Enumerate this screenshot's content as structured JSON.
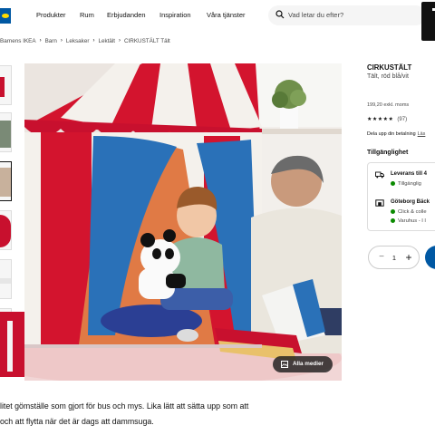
{
  "header": {
    "nav": [
      "Produkter",
      "Rum",
      "Erbjudanden",
      "Inspiration",
      "Våra tjänster"
    ],
    "search_placeholder": "Vad letar du efter?"
  },
  "breadcrumb": [
    "Barnens IKEA",
    "Barn",
    "Leksaker",
    "Lektält",
    "CIRKUSTÄLT Tält"
  ],
  "gallery": {
    "media_button": "Alla medier"
  },
  "product": {
    "name": "CIRKUSTÄLT",
    "subtitle": "Tält, röd blå/vit",
    "price": "199,20 exkl. moms",
    "rating_stars": "★★★★★",
    "rating_count": "(97)",
    "split_text": "Dela upp din betalning",
    "split_link": "Läs",
    "availability_title": "Tillgänglighet",
    "delivery": {
      "title": "Leverans till 4",
      "status": "Tillgänglig"
    },
    "store": {
      "title": "Göteborg Bäck",
      "line1": "Click & colle",
      "line2": "Varuhus - I l"
    },
    "quantity": "1",
    "minus": "−",
    "plus": "+"
  },
  "description": {
    "line1": "litet gömställe som gjort för bus och mys. Lika lätt att sätta upp som att",
    "line2": "och att flytta när det är dags att dammsuga."
  },
  "colors": {
    "ikea_blue": "#0058a3",
    "ikea_yellow": "#ffdb00",
    "tent_red": "#c8102e",
    "available_green": "#0a8a00"
  }
}
